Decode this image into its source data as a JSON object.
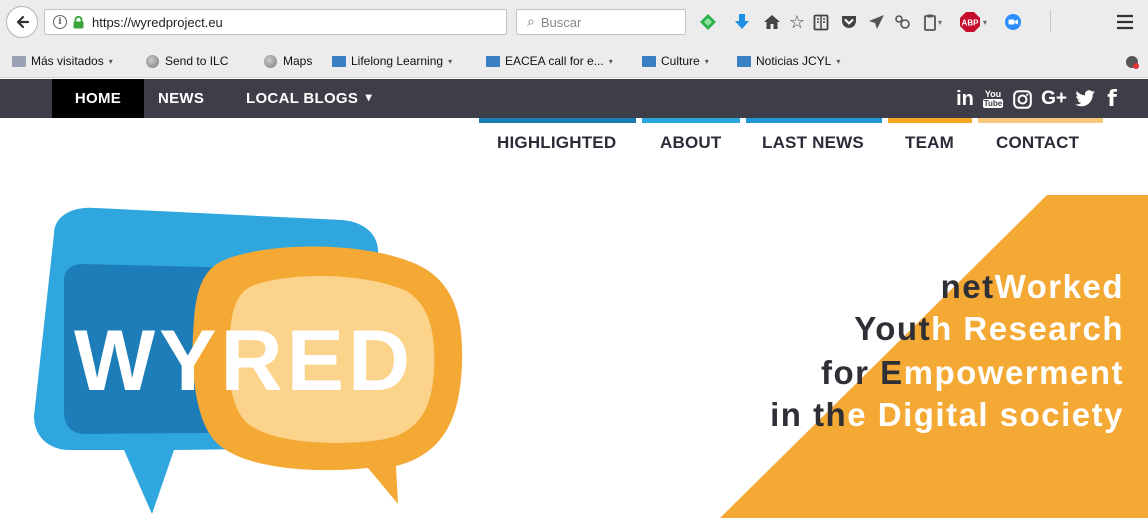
{
  "browser": {
    "url": "https://wyredproject.eu",
    "search_placeholder": "Buscar",
    "reload_glyph": "↻",
    "search_glyph": "🔍",
    "abp_label": "ABP",
    "toolbar_icons": [
      "back-icon",
      "info-icon",
      "lock-icon",
      "reload-icon",
      "search-icon",
      "feedly-icon",
      "download-icon",
      "home-icon",
      "bookmark-star-icon",
      "reading-list-icon",
      "pocket-icon",
      "send-icon",
      "extension-icon",
      "clipboard-icon",
      "adblock-icon",
      "zoom-icon",
      "menu-icon"
    ]
  },
  "bookmarks": [
    {
      "label": "Más visitados",
      "icon": "folder-icon",
      "dropdown": true
    },
    {
      "label": "Send to ILC",
      "icon": "globe-icon",
      "dropdown": false
    },
    {
      "label": "Maps",
      "icon": "globe-icon",
      "dropdown": false
    },
    {
      "label": "Lifelong Learning",
      "icon": "rss-folder-icon",
      "dropdown": true
    },
    {
      "label": "EACEA call for e...",
      "icon": "rss-folder-icon",
      "dropdown": true
    },
    {
      "label": "Culture",
      "icon": "rss-folder-icon",
      "dropdown": true
    },
    {
      "label": "Noticias JCYL",
      "icon": "rss-folder-icon",
      "dropdown": true
    }
  ],
  "site_nav": {
    "home": "HOME",
    "news": "NEWS",
    "local_blogs": "LOCAL BLOGS",
    "local_blogs_caret": "⌄"
  },
  "social": {
    "linkedin": "in",
    "youtube_top": "You",
    "youtube_bottom": "Tube",
    "googleplus": "G+",
    "twitter": "🐦",
    "facebook": "f"
  },
  "subnav": {
    "items": [
      "HIGHLIGHTED",
      "ABOUT",
      "LAST NEWS",
      "TEAM",
      "CONTACT"
    ],
    "strip_colors": [
      "#1a7fb0",
      "#29a8e0",
      "#2396d4",
      "#f5a623",
      "#f9c77a"
    ]
  },
  "hero": {
    "logo_text": "WYRED",
    "tagline": [
      {
        "dark": "net",
        "light": "Worked"
      },
      {
        "dark": "Yout",
        "light": "h Research"
      },
      {
        "dark": "for E",
        "light": "mpowerment"
      },
      {
        "dark": "in th",
        "light": "e Digital society"
      }
    ]
  },
  "colors": {
    "nav_bg": "#3e3e48",
    "brand_blue": "#2fa7de",
    "brand_blue_dark": "#1d7db9",
    "brand_orange": "#f5a935",
    "brand_orange_light": "#fcd38a",
    "tagline_dark": "#2f3036"
  }
}
